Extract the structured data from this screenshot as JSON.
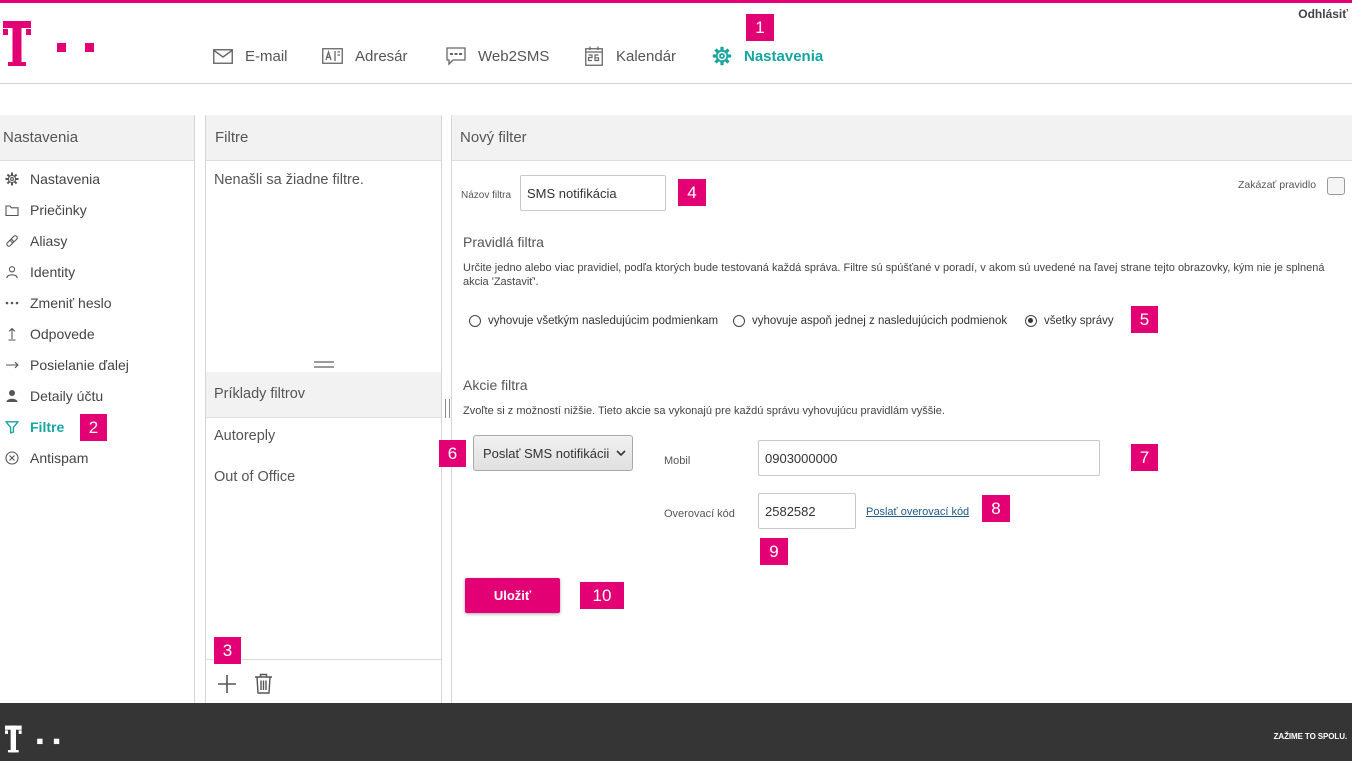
{
  "colors": {
    "brand": "#e20074",
    "active": "#16a5a3",
    "footer_bg": "#353535",
    "link": "#1f5a8c"
  },
  "header": {
    "logout": "Odhlásiť",
    "nav": [
      {
        "label": "E-mail",
        "icon": "envelope-icon",
        "active": false
      },
      {
        "label": "Adresár",
        "icon": "address-book-icon",
        "active": false
      },
      {
        "label": "Web2SMS",
        "icon": "sms-icon",
        "active": false
      },
      {
        "label": "Kalendár",
        "icon": "calendar-icon",
        "active": false
      },
      {
        "label": "Nastavenia",
        "icon": "gear-icon",
        "active": true
      }
    ]
  },
  "sidebar": {
    "title": "Nastavenia",
    "items": [
      {
        "label": "Nastavenia",
        "icon": "gear-icon",
        "active": false
      },
      {
        "label": "Priečinky",
        "icon": "folder-icon",
        "active": false
      },
      {
        "label": "Aliasy",
        "icon": "link-icon",
        "active": false
      },
      {
        "label": "Identity",
        "icon": "person-outline-icon",
        "active": false
      },
      {
        "label": "Zmeniť heslo",
        "icon": "dots-icon",
        "active": false
      },
      {
        "label": "Odpovede",
        "icon": "arrow-up-icon",
        "active": false
      },
      {
        "label": "Posielanie ďalej",
        "icon": "arrow-right-icon",
        "active": false
      },
      {
        "label": "Detaily účtu",
        "icon": "person-filled-icon",
        "active": false
      },
      {
        "label": "Filtre",
        "icon": "filter-icon",
        "active": true
      },
      {
        "label": "Antispam",
        "icon": "x-circle-icon",
        "active": false
      }
    ]
  },
  "filters": {
    "title": "Filtre",
    "empty_text": "Nenašli sa žiadne filtre.",
    "examples_title": "Príklady filtrov",
    "examples": [
      "Autoreply",
      "Out of Office"
    ],
    "toolbar": {
      "add_icon": "plus-icon",
      "delete_icon": "trash-icon"
    }
  },
  "form": {
    "title": "Nový filter",
    "name_label": "Názov filtra",
    "name_value": "SMS notifikácia",
    "disable_label": "Zakázať pravidlo",
    "disable_checked": false,
    "rules_title": "Pravidlá filtra",
    "rules_description": "Určite jedno alebo viac pravidiel, podľa ktorých bude testovaná každá správa. Filtre sú spúšťané v poradí, v akom sú uvedené na ľavej strane tejto obrazovky, kým nie je splnená akcia 'Zastaviť'.",
    "match_options": [
      {
        "label": "vyhovuje všetkým nasledujúcim podmienkam",
        "selected": false
      },
      {
        "label": "vyhovuje aspoň jednej z nasledujúcich podmienok",
        "selected": false
      },
      {
        "label": "všetky správy",
        "selected": true
      }
    ],
    "actions_title": "Akcie filtra",
    "actions_description": "Zvoľte si z možností nižšie. Tieto akcie sa vykonajú pre každú správu vyhovujúcu pravidlám vyššie.",
    "action_selected": "Poslať SMS notifikácii",
    "mobile_label": "Mobil",
    "mobile_value": "0903000000",
    "code_label": "Overovací kód",
    "code_value": "2582582",
    "send_code_link": "Poslať overovací kód",
    "save_label": "Uložiť"
  },
  "annotations": [
    "1",
    "2",
    "3",
    "4",
    "5",
    "6",
    "7",
    "8",
    "9",
    "10"
  ],
  "footer": {
    "slogan": "ZAŽIME TO SPOLU."
  }
}
